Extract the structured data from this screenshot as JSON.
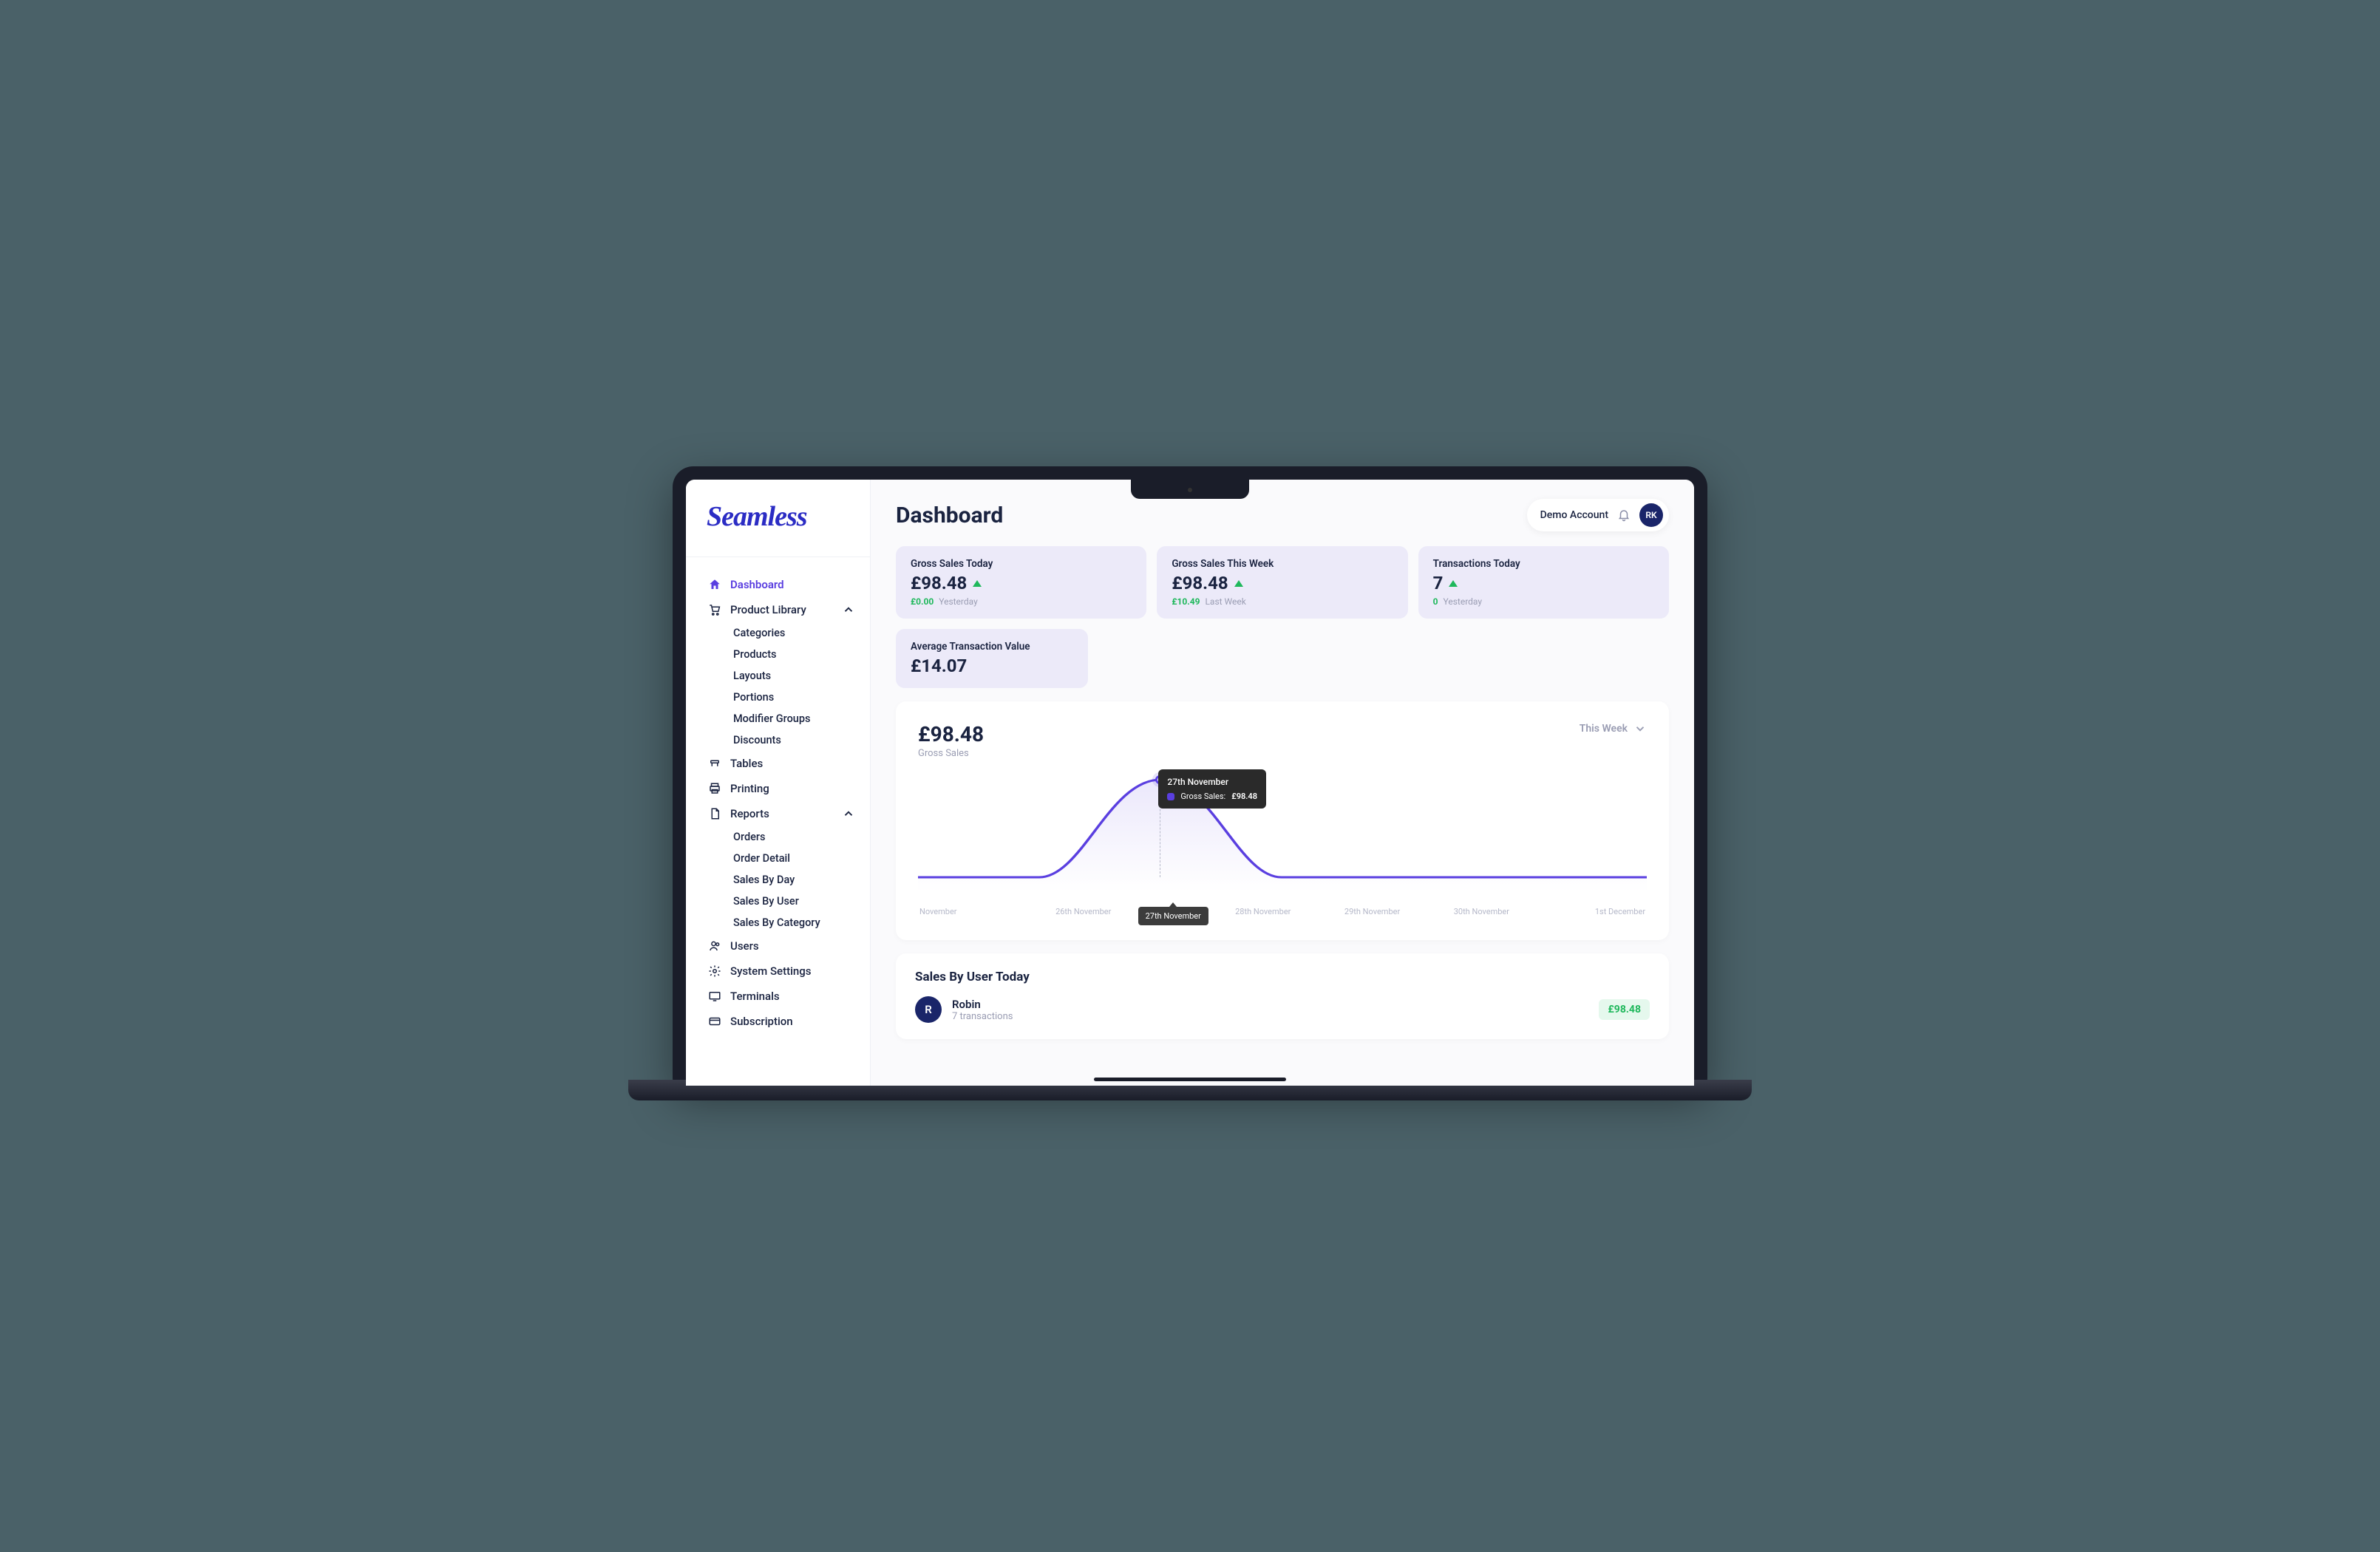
{
  "brand": "Seamless",
  "page_title": "Dashboard",
  "account": {
    "name": "Demo Account",
    "initials": "RK"
  },
  "sidebar": {
    "dashboard": "Dashboard",
    "product_library": "Product Library",
    "pl_items": [
      "Categories",
      "Products",
      "Layouts",
      "Portions",
      "Modifier Groups",
      "Discounts"
    ],
    "tables": "Tables",
    "printing": "Printing",
    "reports": "Reports",
    "rep_items": [
      "Orders",
      "Order Detail",
      "Sales By Day",
      "Sales By User",
      "Sales By Category"
    ],
    "users": "Users",
    "system_settings": "System Settings",
    "terminals": "Terminals",
    "subscription": "Subscription"
  },
  "stats": [
    {
      "title": "Gross Sales Today",
      "value": "£98.48",
      "trend": "up",
      "sub_green": "£0.00",
      "sub_grey": "Yesterday"
    },
    {
      "title": "Gross Sales This Week",
      "value": "£98.48",
      "trend": "up",
      "sub_green": "£10.49",
      "sub_grey": "Last Week"
    },
    {
      "title": "Transactions Today",
      "value": "7",
      "trend": "up",
      "sub_green": "0",
      "sub_grey": "Yesterday"
    },
    {
      "title": "Average Transaction Value",
      "value": "£14.07"
    }
  ],
  "chart": {
    "value": "£98.48",
    "subtitle": "Gross Sales",
    "period": "This Week",
    "tooltip": {
      "date": "27th November",
      "label": "Gross Sales:",
      "value": "£98.48"
    },
    "x_labels": [
      "November",
      "26th November",
      "27th November",
      "28th November",
      "29th November",
      "30th November",
      "1st December"
    ]
  },
  "chart_data": {
    "type": "area",
    "title": "Gross Sales",
    "xlabel": "",
    "ylabel": "£",
    "x": [
      "November",
      "26th November",
      "27th November",
      "28th November",
      "29th November",
      "30th November",
      "1st December"
    ],
    "series": [
      {
        "name": "Gross Sales",
        "values": [
          0,
          0,
          98.48,
          0,
          0,
          0,
          0
        ],
        "color": "#5a3fe0"
      }
    ],
    "ylim": [
      0,
      100
    ],
    "highlight": {
      "index": 2,
      "label": "27th November",
      "value": 98.48
    }
  },
  "sales_by_user": {
    "title": "Sales By User Today",
    "rows": [
      {
        "initial": "R",
        "name": "Robin",
        "tx": "7 transactions",
        "amount": "£98.48"
      }
    ]
  }
}
